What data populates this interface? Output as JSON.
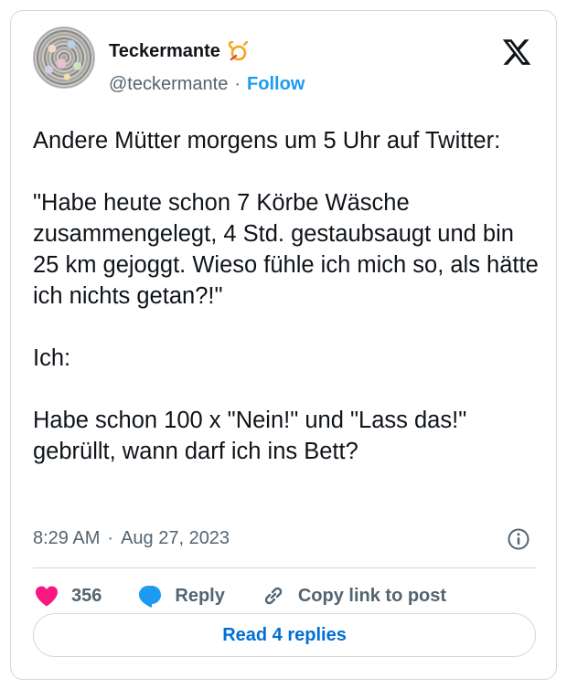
{
  "user": {
    "display_name": "Teckermante",
    "badge_icon": "post-horn-emoji",
    "handle": "@teckermante",
    "separator": "·",
    "follow_label": "Follow"
  },
  "brand": {
    "logo_icon": "x-logo-icon"
  },
  "tweet": {
    "text": "Andere Mütter morgens um 5 Uhr auf Twitter:\n\n\"Habe heute schon 7 Körbe Wäsche zusammengelegt, 4 Std. gestaubsaugt und bin 25 km gejoggt. Wieso fühle ich mich so, als hätte ich nichts getan?!\"\n\nIch:\n\nHabe schon 100 x \"Nein!\" und \"Lass das!\" gebrüllt, wann darf ich ins Bett?",
    "time": "8:29 AM",
    "separator": "·",
    "date": "Aug 27, 2023"
  },
  "actions": {
    "like_count": "356",
    "reply_label": "Reply",
    "copy_label": "Copy link to post"
  },
  "read_replies_label": "Read 4 replies",
  "colors": {
    "accent": "#1d9bf0",
    "like": "#f91880",
    "reply_bubble": "#1d9bf0",
    "read_button_text": "#006fd6",
    "text_primary": "#0f1419",
    "text_secondary": "#536471",
    "border": "#cfd9de"
  }
}
